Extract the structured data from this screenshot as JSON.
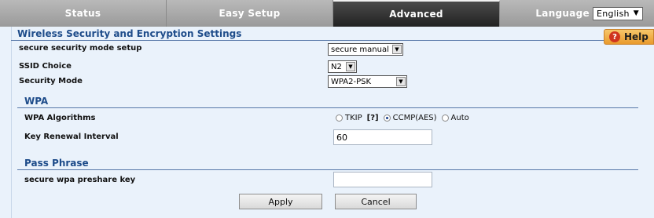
{
  "nav": {
    "tabs": [
      {
        "label": "Status"
      },
      {
        "label": "Easy Setup"
      },
      {
        "label": "Advanced"
      }
    ],
    "language_label": "Language",
    "language_value": "English"
  },
  "help_label": "Help",
  "section_title": "Wireless Security and Encryption Settings",
  "fields": {
    "mode_setup_label": "secure security mode setup",
    "mode_setup_value": "secure manual",
    "ssid_label": "SSID Choice",
    "ssid_value": "N2",
    "security_mode_label": "Security Mode",
    "security_mode_value": "WPA2-PSK"
  },
  "wpa": {
    "title": "WPA",
    "algorithms_label": "WPA Algorithms",
    "options": [
      {
        "label": "TKIP",
        "checked": false
      },
      {
        "label": "CCMP(AES)",
        "checked": true
      },
      {
        "label": "Auto",
        "checked": false
      }
    ],
    "help_bracket": "[?]",
    "renewal_label": "Key Renewal Interval",
    "renewal_value": "60"
  },
  "passphrase": {
    "title": "Pass Phrase",
    "key_label": "secure wpa preshare key",
    "key_value": ""
  },
  "buttons": {
    "apply": "Apply",
    "cancel": "Cancel"
  },
  "colors": {
    "accent": "#1e4c8a",
    "panel_bg": "#eaf2fb",
    "help_orange": "#e99a2c"
  }
}
